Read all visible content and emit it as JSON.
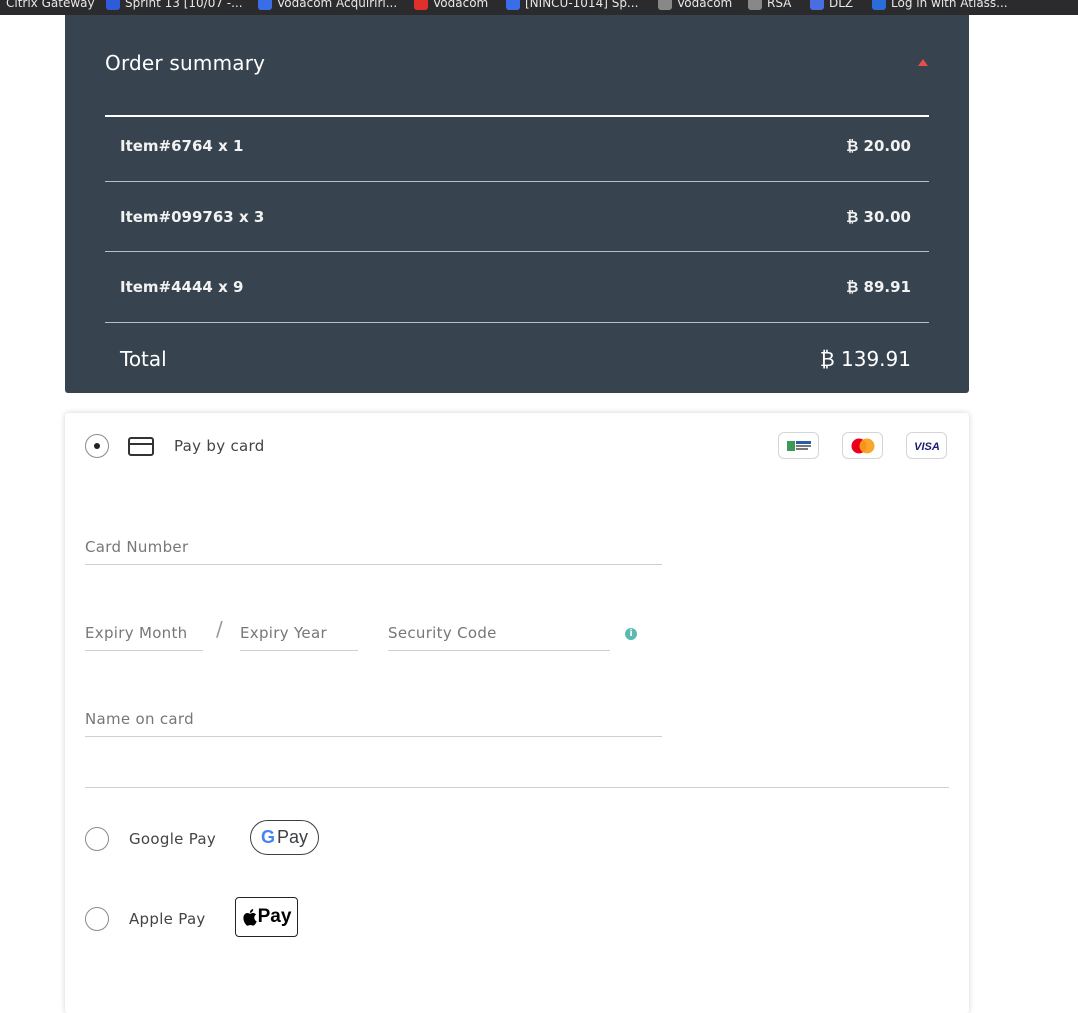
{
  "bookmarks": [
    {
      "label": "Citrix Gateway",
      "color": "#6b6b6b"
    },
    {
      "label": "Sprint 13 [10/07 -...",
      "color": "#2e5bd8"
    },
    {
      "label": "Vodacom Acquiriri...",
      "color": "#3a6ee8"
    },
    {
      "label": "Vodacom",
      "color": "#e0302a"
    },
    {
      "label": "[NINCU-1014] Sp...",
      "color": "#3a6ee8"
    },
    {
      "label": "Vodacom",
      "color": "#888888"
    },
    {
      "label": "RSA",
      "color": "#888888"
    },
    {
      "label": "DLZ",
      "color": "#4a6ee0"
    },
    {
      "label": "Log in with Atlass...",
      "color": "#2a6cd8"
    }
  ],
  "summary": {
    "title": "Order summary",
    "items": [
      {
        "name": "Item#6764 x 1",
        "price": "₿ 20.00"
      },
      {
        "name": "Item#099763 x 3",
        "price": "₿ 30.00"
      },
      {
        "name": "Item#4444 x 9",
        "price": "₿ 89.91"
      }
    ],
    "total_label": "Total",
    "total_value": "₿ 139.91",
    "caret_color": "#e94f48"
  },
  "payment": {
    "card": {
      "label": "Pay by card",
      "selected": true,
      "brands": [
        "local-cards",
        "Mastercard",
        "VISA"
      ]
    },
    "fields": {
      "card_number": "Card Number",
      "expiry_month": "Expiry Month",
      "expiry_separator": "/",
      "expiry_year": "Expiry Year",
      "security_code": "Security Code",
      "name_on_card": "Name on card"
    },
    "google_pay": {
      "label": "Google Pay",
      "badge_text": "Pay"
    },
    "apple_pay": {
      "label": "Apple Pay",
      "badge_text": "Pay"
    }
  }
}
